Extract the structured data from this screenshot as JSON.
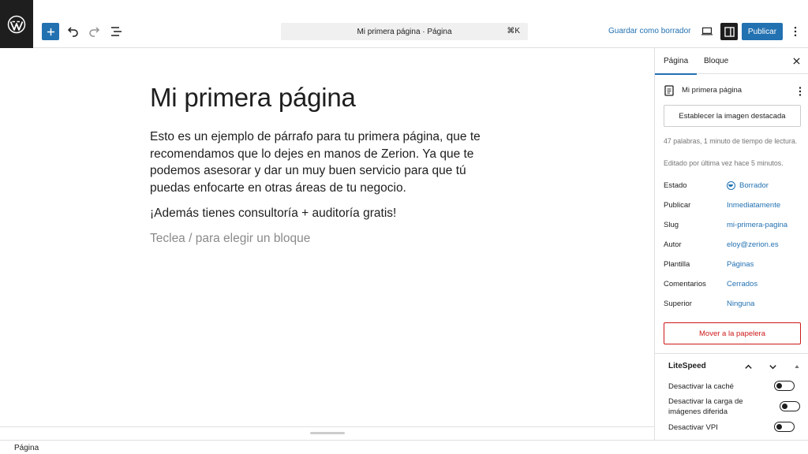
{
  "toolbar": {
    "command_bar": "Mi primera página · Página",
    "shortcut": "⌘K",
    "save_draft": "Guardar como borrador",
    "publish": "Publicar"
  },
  "editor": {
    "title": "Mi primera página",
    "paragraph1": "Esto es un ejemplo de párrafo para tu primera página, que te recomendamos que lo dejes en manos de Zerion. Ya que te podemos asesorar y dar un muy buen servicio para que tú puedas enfocarte en otras áreas de tu negocio.",
    "paragraph2": "¡Además tienes consultoría + auditoría gratis!",
    "placeholder": "Teclea / para elegir un bloque"
  },
  "footer": {
    "breadcrumb": "Página"
  },
  "sidebar": {
    "tabs": [
      "Página",
      "Bloque"
    ],
    "doc_title": "Mi primera página",
    "featured_image": "Establecer la imagen destacada",
    "word_count": "47 palabras, 1 minuto de tiempo de lectura.",
    "last_edited": "Editado por última vez hace 5 minutos.",
    "fields": [
      {
        "label": "Estado",
        "value": "Borrador"
      },
      {
        "label": "Publicar",
        "value": "Inmediatamente"
      },
      {
        "label": "Slug",
        "value": "mi-primera-pagina"
      },
      {
        "label": "Autor",
        "value": "eloy@zerion.es"
      },
      {
        "label": "Plantilla",
        "value": "Páginas"
      },
      {
        "label": "Comentarios",
        "value": "Cerrados"
      },
      {
        "label": "Superior",
        "value": "Ninguna"
      }
    ],
    "trash": "Mover a la papelera",
    "litespeed": {
      "title": "LiteSpeed",
      "options": [
        {
          "label": "Desactivar la caché",
          "enabled": false
        },
        {
          "label": "Desactivar la carga de imágenes diferida",
          "enabled": false
        },
        {
          "label": "Desactivar VPI",
          "enabled": false
        }
      ]
    }
  },
  "colors": {
    "accent": "#2271b1",
    "danger": "#cc1818",
    "dark": "#1e1e1e"
  }
}
